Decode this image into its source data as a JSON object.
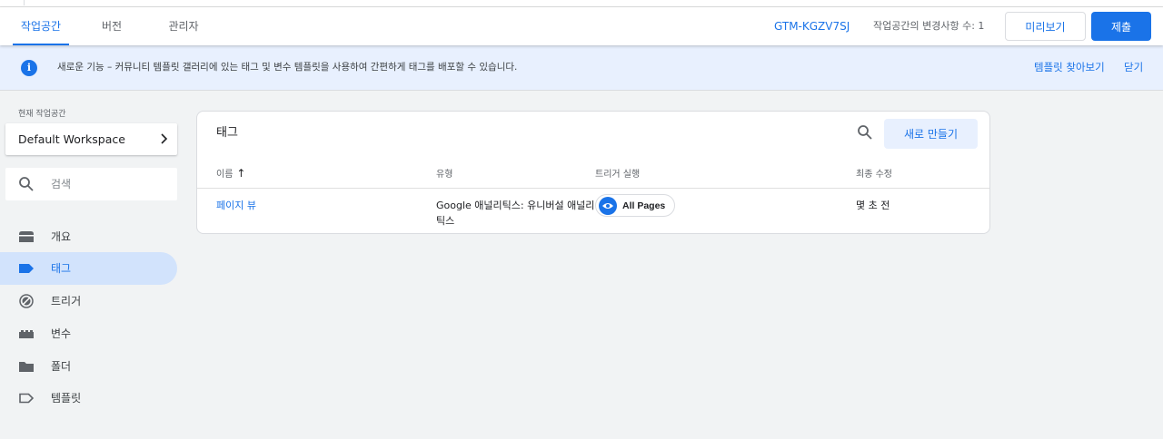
{
  "header": {
    "tabs": [
      {
        "label": "작업공간",
        "active": true
      },
      {
        "label": "버전",
        "active": false
      },
      {
        "label": "관리자",
        "active": false
      }
    ],
    "container_id": "GTM-KGZV7SJ",
    "changes_text": "작업공간의 변경사항 수: 1",
    "preview_label": "미리보기",
    "submit_label": "제출"
  },
  "banner": {
    "icon": "info-icon",
    "text": "새로운 기능 – 커뮤니티 템플릿 갤러리에 있는 태그 및 변수 템플릿을 사용하여 간편하게 태그를 배포할 수 있습니다.",
    "link_templates": "템플릿 찾아보기",
    "link_close": "닫기"
  },
  "sidebar": {
    "workspace_label": "현재 작업공간",
    "workspace_name": "Default Workspace",
    "search_placeholder": "검색",
    "items": [
      {
        "label": "개요",
        "icon": "overview-icon",
        "active": false
      },
      {
        "label": "태그",
        "icon": "tag-icon",
        "active": true
      },
      {
        "label": "트리거",
        "icon": "trigger-icon",
        "active": false
      },
      {
        "label": "변수",
        "icon": "variable-icon",
        "active": false
      },
      {
        "label": "폴더",
        "icon": "folder-icon",
        "active": false
      },
      {
        "label": "템플릿",
        "icon": "template-icon",
        "active": false
      }
    ]
  },
  "tags_card": {
    "title": "태그",
    "new_button": "새로 만들기",
    "columns": {
      "name": "이름",
      "type": "유형",
      "trigger": "트리거 실행",
      "modified": "최종 수정"
    },
    "rows": [
      {
        "name": "페이지 뷰",
        "type": "Google 애널리틱스: 유니버설 애널리틱스",
        "trigger": "All Pages",
        "modified": "몇 초 전"
      }
    ]
  },
  "colors": {
    "accent": "#1a73e8",
    "banner_bg": "#e8f0fe",
    "active_nav_bg": "#d2e3fc",
    "page_bg": "#f1f3f4"
  }
}
